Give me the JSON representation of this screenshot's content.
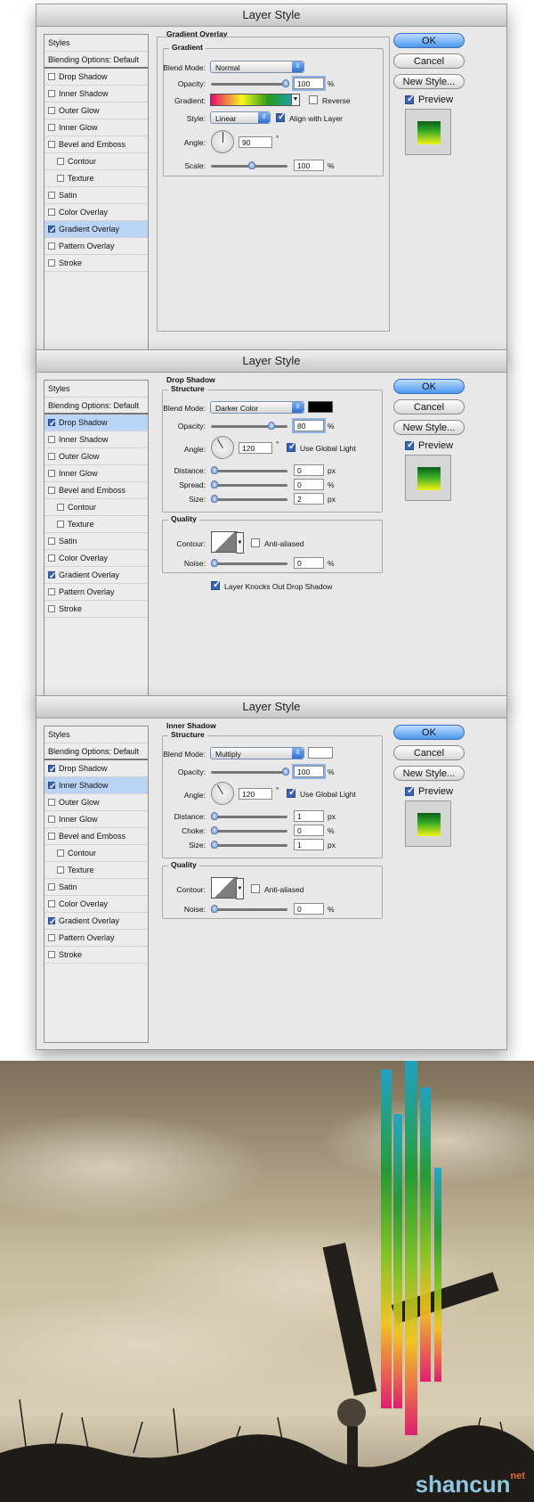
{
  "dialog_title": "Layer Style",
  "styles_list": [
    "Styles",
    "Blending Options: Default",
    "Drop Shadow",
    "Inner Shadow",
    "Outer Glow",
    "Inner Glow",
    "Bevel and Emboss",
    "Contour",
    "Texture",
    "Satin",
    "Color Overlay",
    "Gradient Overlay",
    "Pattern Overlay",
    "Stroke"
  ],
  "buttons": {
    "ok": "OK",
    "cancel": "Cancel",
    "new_style": "New Style...",
    "preview": "Preview"
  },
  "panel1": {
    "checked": {
      "Drop Shadow": false,
      "Inner Shadow": false,
      "Gradient Overlay": true
    },
    "section": "Gradient Overlay",
    "group": "Gradient",
    "blend_mode_label": "Blend Mode:",
    "blend_mode": "Normal",
    "opacity_label": "Opacity:",
    "opacity": "100",
    "opacity_level": 1.0,
    "gradient_label": "Gradient:",
    "reverse_label": "Reverse",
    "reverse": false,
    "style_label": "Style:",
    "style": "Linear",
    "align_label": "Align with Layer",
    "align": true,
    "angle_label": "Angle:",
    "angle": "90",
    "angle_unit": "°",
    "scale_label": "Scale:",
    "scale": "100",
    "scale_level": 0.5,
    "unit_pct": "%"
  },
  "panel2": {
    "checked": {
      "Drop Shadow": true,
      "Inner Shadow": false,
      "Gradient Overlay": true
    },
    "section": "Drop Shadow",
    "structure": "Structure",
    "blend_mode_label": "Blend Mode:",
    "blend_mode": "Darker Color",
    "swatch_color": "#000000",
    "opacity_label": "Opacity:",
    "opacity": "80",
    "opacity_level": 0.8,
    "angle_label": "Angle:",
    "angle": "120",
    "angle_unit": "°",
    "global_light_label": "Use Global Light",
    "global_light": true,
    "distance_label": "Distance:",
    "distance": "0",
    "distance_unit": "px",
    "spread_label": "Spread:",
    "spread": "0",
    "spread_unit": "%",
    "size_label": "Size:",
    "size": "2",
    "size_unit": "px",
    "quality": "Quality",
    "contour_label": "Contour:",
    "anti_aliased_label": "Anti-aliased",
    "noise_label": "Noise:",
    "noise": "0",
    "noise_unit": "%",
    "knockout_label": "Layer Knocks Out Drop Shadow",
    "knockout": true,
    "unit_pct": "%"
  },
  "panel3": {
    "checked": {
      "Drop Shadow": true,
      "Inner Shadow": true,
      "Gradient Overlay": true
    },
    "section": "Inner Shadow",
    "structure": "Structure",
    "blend_mode_label": "Blend Mode:",
    "blend_mode": "Multiply",
    "swatch_color": "#ffffff",
    "opacity_label": "Opacity:",
    "opacity": "100",
    "opacity_level": 1.0,
    "angle_label": "Angle:",
    "angle": "120",
    "angle_unit": "°",
    "global_light_label": "Use Global Light",
    "global_light": true,
    "distance_label": "Distance:",
    "distance": "1",
    "distance_unit": "px",
    "choke_label": "Choke:",
    "choke": "0",
    "choke_unit": "%",
    "size_label": "Size:",
    "size": "1",
    "size_unit": "px",
    "quality": "Quality",
    "contour_label": "Contour:",
    "anti_aliased_label": "Anti-aliased",
    "noise_label": "Noise:",
    "noise": "0",
    "noise_unit": "%",
    "unit_pct": "%"
  },
  "photo": {
    "watermark_main": "shancun",
    "watermark_small": "net"
  }
}
